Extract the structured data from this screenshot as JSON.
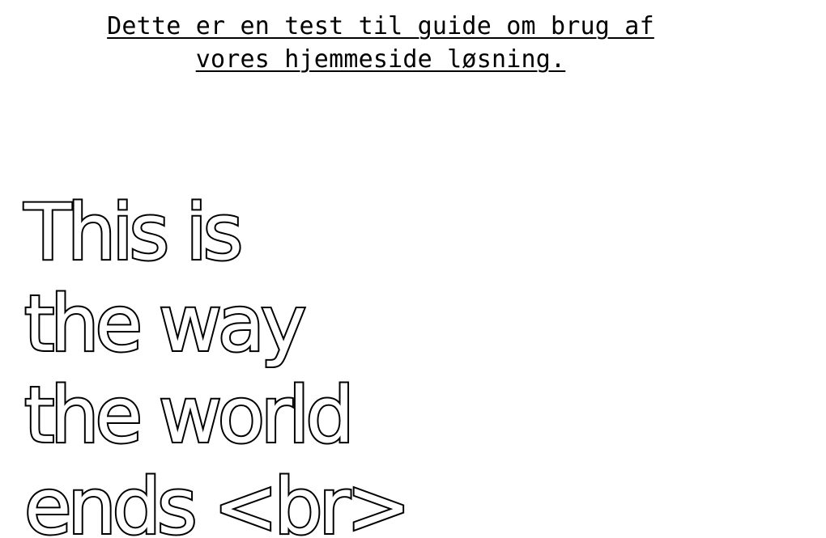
{
  "intro": {
    "line1": "Dette er en test til guide om brug af",
    "line2": "vores hjemmeside løsning."
  },
  "headline": {
    "line1": "This is",
    "line2": "the way",
    "line3": "the world",
    "line4": "ends <br>"
  },
  "colors": {
    "background": "#ffffff",
    "text": "#000000",
    "outline_fill": "#ffffff"
  }
}
